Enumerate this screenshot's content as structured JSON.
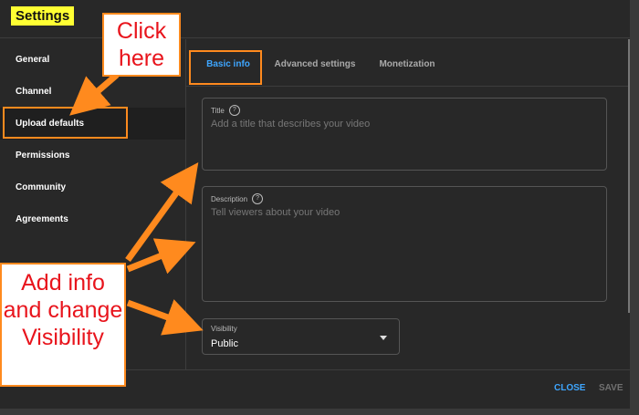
{
  "dialog": {
    "title": "Settings"
  },
  "sidebar": {
    "items": [
      {
        "label": "General"
      },
      {
        "label": "Channel"
      },
      {
        "label": "Upload defaults"
      },
      {
        "label": "Permissions"
      },
      {
        "label": "Community"
      },
      {
        "label": "Agreements"
      }
    ],
    "active_index": 2
  },
  "tabs": [
    {
      "label": "Basic info"
    },
    {
      "label": "Advanced settings"
    },
    {
      "label": "Monetization"
    }
  ],
  "form": {
    "title": {
      "label": "Title",
      "placeholder": "Add a title that describes your video"
    },
    "description": {
      "label": "Description",
      "placeholder": "Tell viewers about your video"
    },
    "visibility": {
      "label": "Visibility",
      "value": "Public"
    }
  },
  "footer": {
    "close_label": "CLOSE",
    "save_label": "SAVE"
  },
  "annotations": {
    "click_here": "Click here",
    "add_info": "Add info and change Visibility",
    "color": "#ff8a1e",
    "text_color": "#e8141c"
  },
  "icons": [
    "help-circle-icon",
    "caret-down-icon"
  ]
}
